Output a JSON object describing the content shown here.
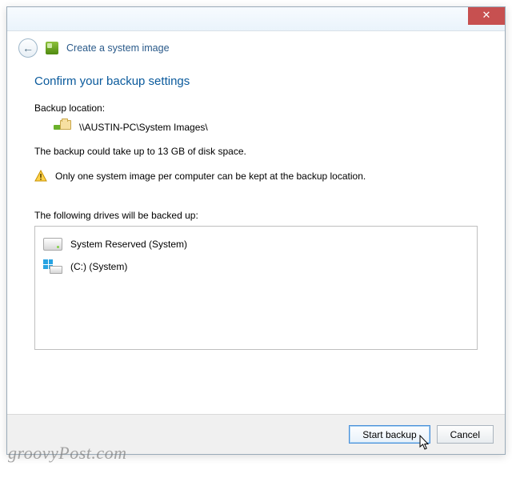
{
  "window": {
    "title": "Create a system image",
    "close_glyph": "✕",
    "back_glyph": "←"
  },
  "main": {
    "heading": "Confirm your backup settings",
    "location_label": "Backup location:",
    "location_path": "\\\\AUSTIN-PC\\System Images\\",
    "size_info": "The backup could take up to 13 GB of disk space.",
    "warning_text": "Only one system image per computer can be kept at the backup location.",
    "drives_label": "The following drives will be backed up:",
    "drives": [
      {
        "name": "System Reserved (System)"
      },
      {
        "name": "(C:) (System)"
      }
    ]
  },
  "footer": {
    "start_label": "Start backup",
    "cancel_label": "Cancel"
  },
  "watermark": "groovyPost.com"
}
